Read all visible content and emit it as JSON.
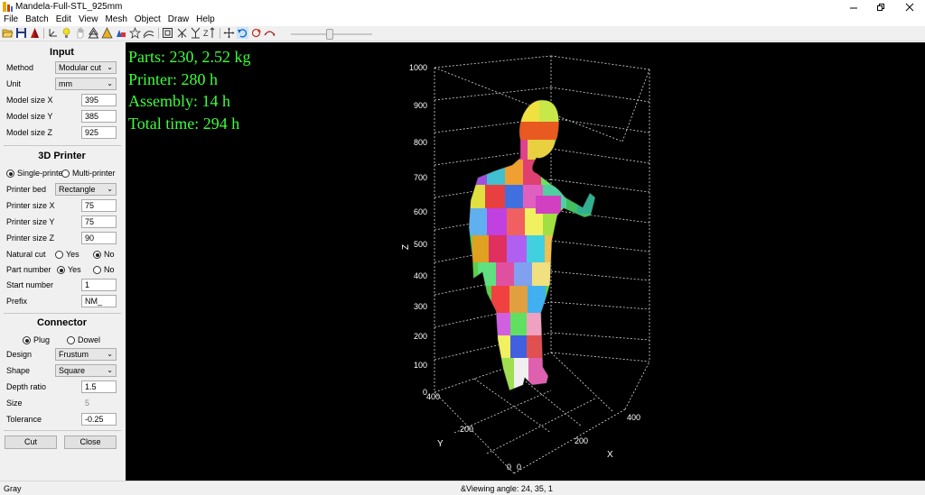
{
  "window": {
    "title": "Mandela-Full-STL_925mm"
  },
  "menu": [
    "File",
    "Batch",
    "Edit",
    "View",
    "Mesh",
    "Object",
    "Draw",
    "Help"
  ],
  "toolbar": {
    "icons": [
      "open-icon",
      "save-icon",
      "pyramid-icon",
      "axes-icon",
      "bulb-icon",
      "hand-icon",
      "tree-icon",
      "triangle-icon",
      "shapes-icon",
      "star-icon",
      "curve-icon",
      "frame-icon",
      "flip-x-icon",
      "flip-y-icon",
      "flip-z-icon",
      "move-icon",
      "undo-icon",
      "rotate-icon",
      "arc-icon"
    ]
  },
  "panel": {
    "input": {
      "title": "Input",
      "method_label": "Method",
      "method_value": "Modular cut",
      "unit_label": "Unit",
      "unit_value": "mm",
      "size_x_label": "Model size X",
      "size_x_value": "395",
      "size_y_label": "Model size Y",
      "size_y_value": "385",
      "size_z_label": "Model size Z",
      "size_z_value": "925"
    },
    "printer": {
      "title": "3D Printer",
      "single_label": "Single-printer",
      "multi_label": "Multi-printer",
      "bed_label": "Printer bed",
      "bed_value": "Rectangle",
      "px_label": "Printer size X",
      "px_value": "75",
      "py_label": "Printer size Y",
      "py_value": "75",
      "pz_label": "Printer size Z",
      "pz_value": "90",
      "natural_label": "Natural cut",
      "natural_yes": "Yes",
      "natural_no": "No",
      "partnum_label": "Part number",
      "partnum_yes": "Yes",
      "partnum_no": "No",
      "start_label": "Start number",
      "start_value": "1",
      "prefix_label": "Prefix",
      "prefix_value": "NM_"
    },
    "connector": {
      "title": "Connector",
      "plug_label": "Plug",
      "dowel_label": "Dowel",
      "design_label": "Design",
      "design_value": "Frustum",
      "shape_label": "Shape",
      "shape_value": "Square",
      "depth_label": "Depth ratio",
      "depth_value": "1.5",
      "size_label": "Size",
      "size_value": "5",
      "tol_label": "Tolerance",
      "tol_value": "-0.25"
    },
    "cut_label": "Cut",
    "close_label": "Close"
  },
  "viewport": {
    "stats": [
      "Parts: 230, 2.52 kg",
      "Printer: 280 h",
      "Assembly: 14 h",
      "Total time: 294 h"
    ],
    "z_ticks": [
      "1000",
      "900",
      "800",
      "700",
      "600",
      "500",
      "400",
      "300",
      "200",
      "100",
      "0"
    ],
    "y_ticks": [
      "400",
      "200",
      "0"
    ],
    "x_ticks": [
      "0",
      "200",
      "400"
    ],
    "axis_x": "X",
    "axis_y": "Y",
    "axis_z": "Z",
    "stats_color": "#3cff3c"
  },
  "status": {
    "left": "Gray",
    "center": "&Viewing angle: 24, 35, 1"
  }
}
